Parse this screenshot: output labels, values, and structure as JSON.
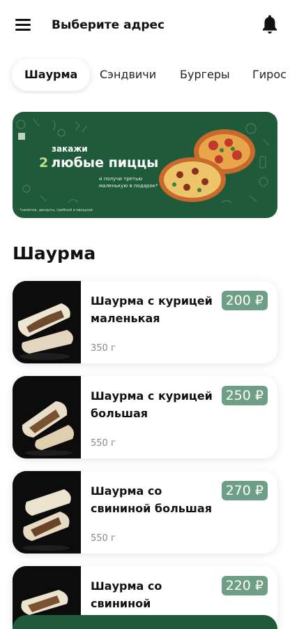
{
  "header": {
    "address_label": "Выберите адрес"
  },
  "tabs": [
    {
      "label": "Шаурма",
      "active": true
    },
    {
      "label": "Сэндвичи",
      "active": false
    },
    {
      "label": "Бургеры",
      "active": false
    },
    {
      "label": "Гирос",
      "active": false
    }
  ],
  "banner": {
    "pre": "закажи",
    "num": "2",
    "main": "любые пиццы",
    "sub1": "и получи третью",
    "sub2": "маленькую в подарок*",
    "fine": "*напитки, десерты, грибной и овощной"
  },
  "section": {
    "title": "Шаурма"
  },
  "items": [
    {
      "name": "Шаурма с курицей маленькая",
      "weight": "350 г",
      "price": "200 ₽"
    },
    {
      "name": "Шаурма с курицей большая",
      "weight": "550 г",
      "price": "250 ₽"
    },
    {
      "name": "Шаурма со свининой большая",
      "weight": "550 г",
      "price": "270 ₽"
    },
    {
      "name": "Шаурма со свининой",
      "weight": "",
      "price": "220 ₽"
    }
  ],
  "colors": {
    "accent_green": "#1f5a3a",
    "price_badge": "#6e9e86"
  }
}
